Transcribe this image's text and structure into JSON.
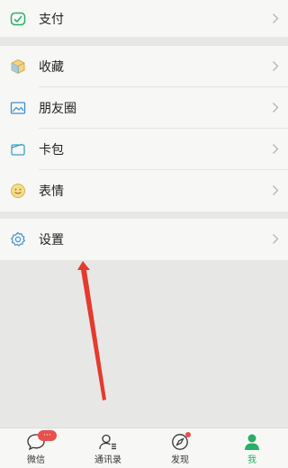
{
  "menu": {
    "pay": "支付",
    "favorites": "收藏",
    "moments": "朋友圈",
    "cards": "卡包",
    "stickers": "表情",
    "settings": "设置"
  },
  "bottom_nav": {
    "chats": {
      "label": "微信",
      "badge": "···"
    },
    "contacts": {
      "label": "通讯录"
    },
    "discover": {
      "label": "发现"
    },
    "me": {
      "label": "我"
    }
  },
  "colors": {
    "accent_green": "#2aae67",
    "badge_red": "#e8504c",
    "annotation_red": "#e53a2f"
  }
}
